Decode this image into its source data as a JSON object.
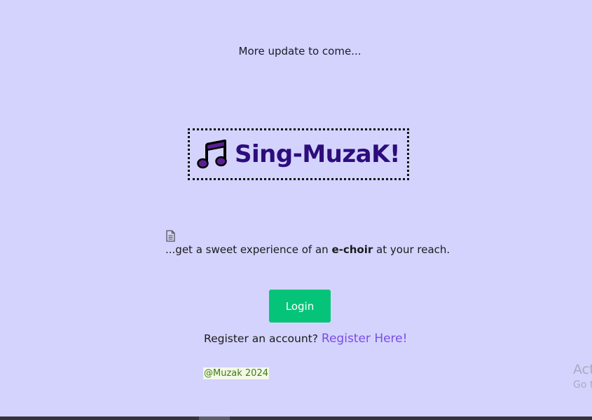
{
  "header": {
    "update_text": "More update to come..."
  },
  "logo": {
    "icon": "music-note-icon",
    "title": "Sing-MuzaK!",
    "color": "#2d0c7c"
  },
  "tagline": {
    "icon": "document-icon",
    "prefix": "...get a sweet experience of an ",
    "emphasis": "e-choir",
    "suffix": " at your reach."
  },
  "login": {
    "label": "Login",
    "color": "#05c47a"
  },
  "register": {
    "prompt": "Register an account?",
    "link_label": "Register Here!",
    "link_color": "#7b4ce8"
  },
  "footer": {
    "copyright": "@Muzak 2024"
  },
  "watermark": {
    "line1": "Act",
    "line2": "Go t"
  },
  "colors": {
    "background": "#d3d3fd"
  }
}
